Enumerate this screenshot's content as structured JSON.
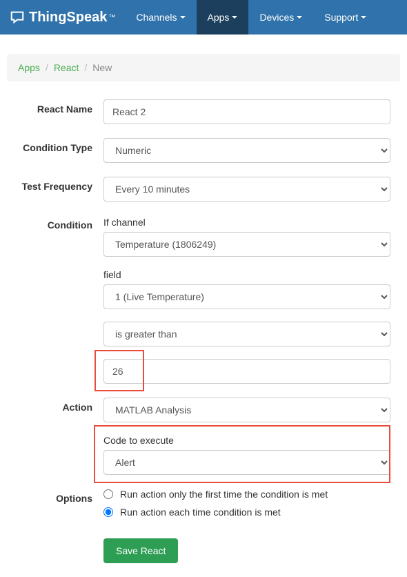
{
  "navbar": {
    "brand": "ThingSpeak",
    "tm": "™",
    "items": [
      {
        "label": "Channels",
        "active": false
      },
      {
        "label": "Apps",
        "active": true
      },
      {
        "label": "Devices",
        "active": false
      },
      {
        "label": "Support",
        "active": false
      }
    ]
  },
  "breadcrumb": {
    "items": [
      "Apps",
      "React"
    ],
    "current": "New"
  },
  "form": {
    "react_name": {
      "label": "React Name",
      "value": "React 2"
    },
    "condition_type": {
      "label": "Condition Type",
      "value": "Numeric"
    },
    "test_frequency": {
      "label": "Test Frequency",
      "value": "Every 10 minutes"
    },
    "condition": {
      "label": "Condition",
      "if_channel_label": "If channel",
      "channel": "Temperature (1806249)",
      "field_label": "field",
      "field": "1 (Live Temperature)",
      "operator": "is greater than",
      "value": "26"
    },
    "action": {
      "label": "Action",
      "value": "MATLAB Analysis",
      "code_label": "Code to execute",
      "code": "Alert"
    },
    "options": {
      "label": "Options",
      "opt1": "Run action only the first time the condition is met",
      "opt2": "Run action each time condition is met",
      "selected": "opt2"
    },
    "save_label": "Save React"
  }
}
